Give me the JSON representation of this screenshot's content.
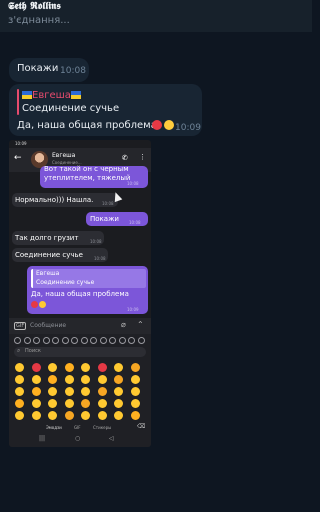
{
  "header": {
    "name": "𝕾𝖊𝖙𝖍 𝕽𝖔𝖑𝖑𝖎𝖓𝖘",
    "status": "з'єднання..."
  },
  "messages": [
    {
      "text": "Покажи",
      "time": "10:08"
    },
    {
      "reply_name": "Евгеша",
      "reply_text": "Соединение сучье",
      "text": "Да, наша общая проблема",
      "time": "10:09"
    }
  ],
  "phone": {
    "status_time": "10:09",
    "chat_name": "Евгеша",
    "chat_status": "Соединение...",
    "bubbles": [
      {
        "text1": "Вот такой он с черным",
        "text2": "утеплителем, тяжелый",
        "time": "10:08"
      },
      {
        "text": "Нормально))) Нашла.",
        "time": "10:08"
      },
      {
        "text": "Покажи",
        "time": "10:08"
      },
      {
        "text": "Так долго грузит",
        "time": "10:08"
      },
      {
        "text": "Соединение сучье",
        "time": "10:08"
      },
      {
        "reply_name": "Евгеша",
        "reply_text": "Соединение сучье",
        "text": "Да, наша общая проблема",
        "time": "10:09"
      }
    ],
    "input_placeholder": "Сообщение",
    "keyboard": {
      "search_placeholder": "Поиск",
      "tabs": [
        "Эмодзи",
        "GIF",
        "Стикеры"
      ]
    }
  },
  "colors": {
    "accent": "#7c56d9",
    "reply_bar": "#e64b6e",
    "bubble": "#182533",
    "background": "#0e1621"
  }
}
